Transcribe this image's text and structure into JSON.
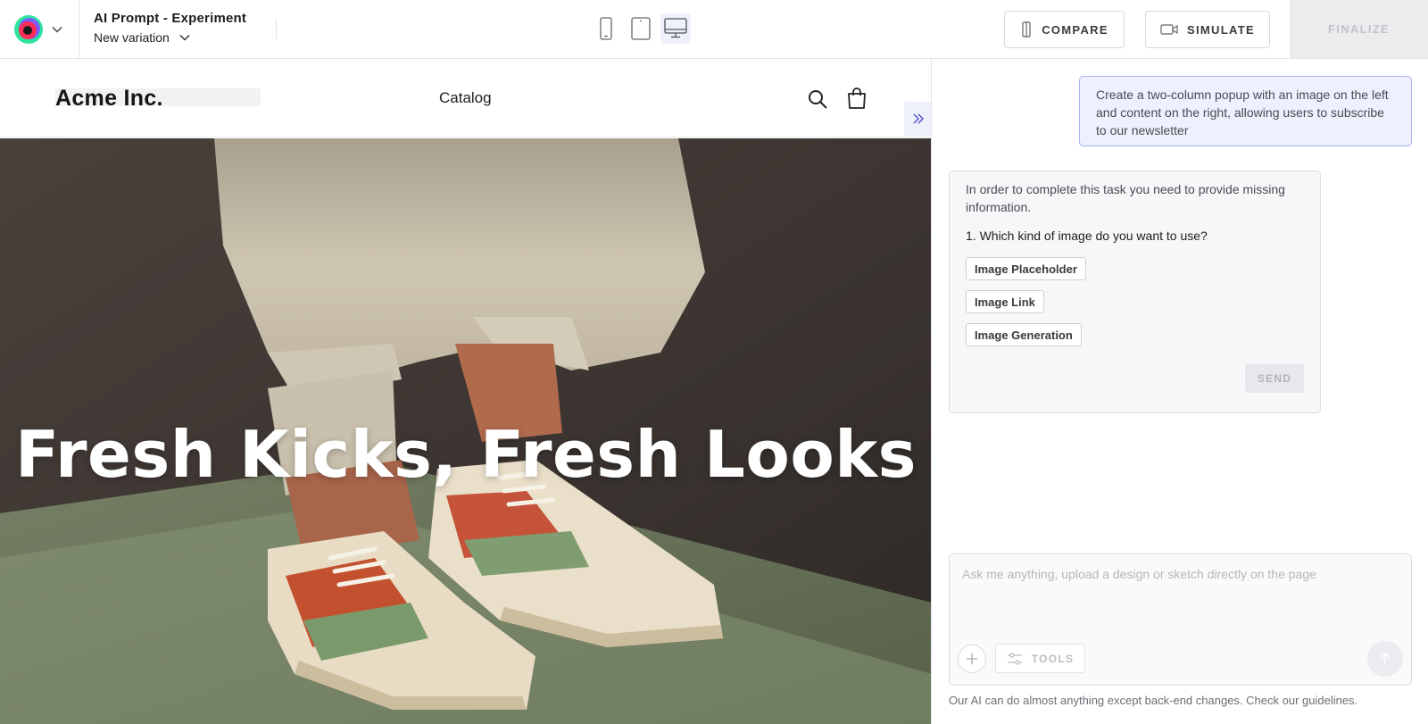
{
  "header": {
    "experiment_title": "AI Prompt - Experiment",
    "variation_label": "New variation",
    "devices": [
      "mobile-icon",
      "tablet-icon",
      "desktop-icon"
    ],
    "active_device": "desktop",
    "compare_label": "COMPARE",
    "simulate_label": "SIMULATE",
    "finalize_label": "FINALIZE"
  },
  "site": {
    "brand": "Acme Inc.",
    "nav_link": "Catalog",
    "hero_title": "Fresh Kicks, Fresh Looks"
  },
  "chat": {
    "user_message": "Create a two-column popup with an image on the left and content on the right, allowing users to subscribe to our newsletter",
    "ai_intro": "In order to complete this task you need to provide missing information.",
    "ai_question": "1. Which kind of image do you want to use?",
    "options": [
      "Image Placeholder",
      "Image Link",
      "Image Generation"
    ],
    "send_label": "SEND",
    "composer_placeholder": "Ask me anything, upload a design or sketch directly on the page",
    "tools_label": "TOOLS",
    "disclaimer": "Our AI can do almost anything except back-end changes. Check our guidelines."
  },
  "colors": {
    "accent": "#4b4fc7",
    "user_bubble_bg": "#eef0fd",
    "user_bubble_border": "#a9b1f2",
    "finalize_bg": "#ececef"
  }
}
